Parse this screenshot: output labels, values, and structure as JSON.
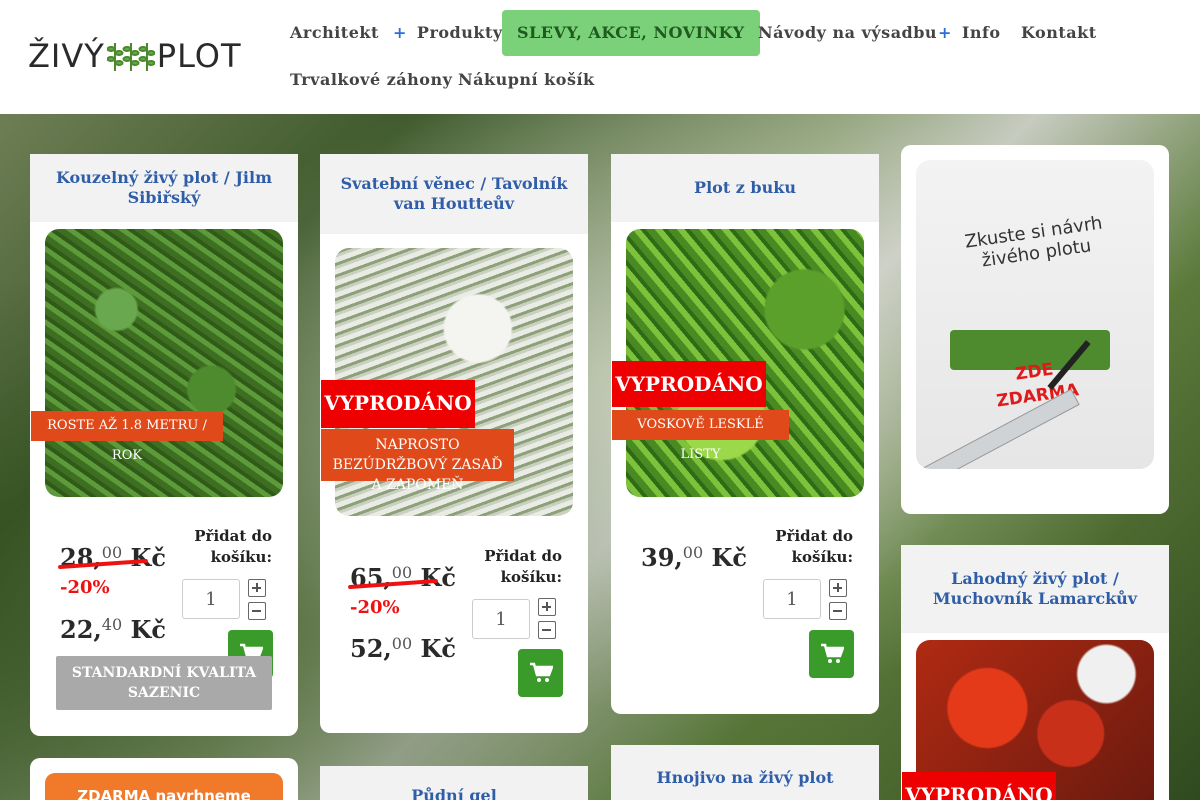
{
  "brand": {
    "logo_left": "ŽIVÝ",
    "logo_right": "PLOT",
    "accent_green": "#7ad17a",
    "link_blue": "#2f5da8",
    "cart_green": "#3a9a2a",
    "sold_red": "#ee0000",
    "tag_orange": "#e04a1a"
  },
  "nav": {
    "items": [
      {
        "label": "Architekt",
        "has_plus": false
      },
      {
        "label": "Produkty",
        "has_plus": true
      },
      {
        "label": "SLEVY, AKCE, NOVINKY",
        "has_plus": false,
        "active": true
      },
      {
        "label": "Návody na výsadbu",
        "has_plus": false
      },
      {
        "label": "Info",
        "has_plus": true
      },
      {
        "label": "Kontakt",
        "has_plus": false
      },
      {
        "label": "Trvalkové záhony",
        "has_plus": false
      },
      {
        "label": "Nákupní košík",
        "has_plus": false
      }
    ],
    "plus_symbol": "+"
  },
  "common": {
    "add_to_cart_label": "Přidat do košíku:",
    "currency": "Kč",
    "sold_out": "VYPRODÁNO",
    "qty_default": "1"
  },
  "products": [
    {
      "title": "Kouzelný živý plot / Jilm Sibiřský",
      "tag": "ROSTE AŽ 1.8 METRU / ROK",
      "old_price_int": "28,",
      "old_price_dec": "00",
      "discount": "-20%",
      "new_price_int": "22,",
      "new_price_dec": "40",
      "quality_button": "STANDARDNÍ KVALITA SAZENIC"
    },
    {
      "title": "Svatební věnec / Tavolník van Houtteův",
      "tag": "NAPROSTO BEZÚDRŽBOVÝ ZASAĎ A ZAPOMEŇ",
      "old_price_int": "65,",
      "old_price_dec": "00",
      "discount": "-20%",
      "new_price_int": "52,",
      "new_price_dec": "00"
    },
    {
      "title": "Plot z buku",
      "tag": "VOSKOVĚ LESKLÉ LISTY",
      "price_int": "39,",
      "price_dec": "00"
    },
    {
      "title": "Lahodný živý plot / Muchovník Lamarckův"
    },
    {
      "title": "Půdní gel"
    },
    {
      "title": "Hnojivo na živý plot"
    }
  ],
  "promo": {
    "line1": "Zkuste si návrh",
    "line2": "živého plotu",
    "line3": "ZDE",
    "line4": "ZDARMA"
  },
  "orange_banner": "ZDARMA navrhneme"
}
